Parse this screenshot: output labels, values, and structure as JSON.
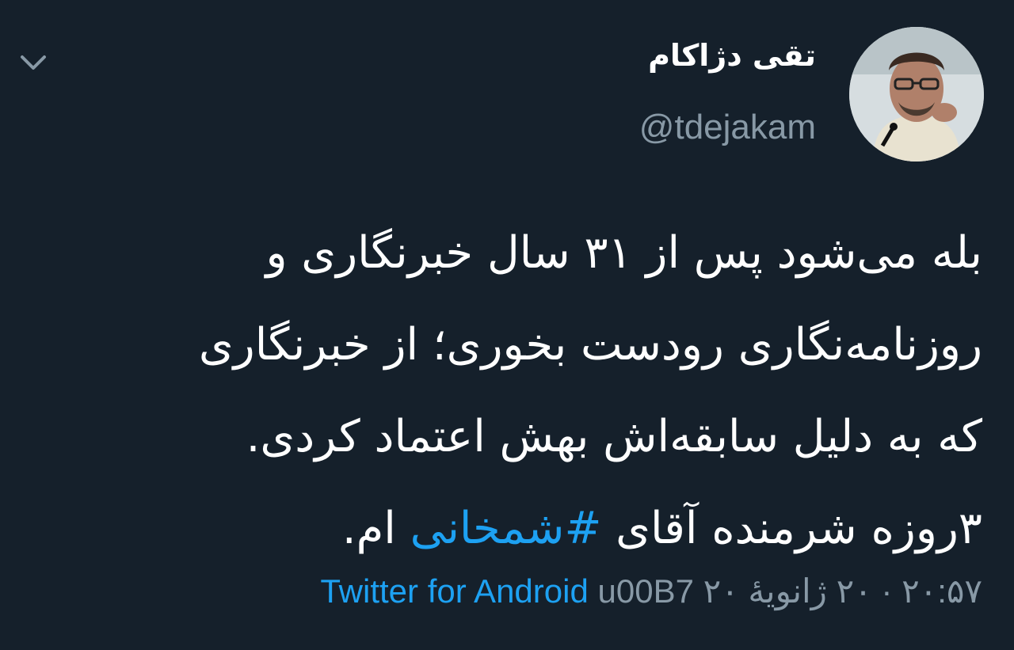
{
  "header": {
    "display_name": "تقی دژاکام",
    "handle": "@tdejakam"
  },
  "icons": {
    "menu": "chevron-down-icon",
    "avatar": "avatar"
  },
  "tweet": {
    "text_line_1": "بله می‌شود پس از ۳۱ سال خبرنگاری و",
    "text_line_2": "روزنامه‌نگاری رودست بخوری؛ از خبرنگاری",
    "text_line_3": "که به دلیل سابقه‌اش بهش اعتماد کردی.",
    "text_line_4_prefix": "۳روزه شرمنده آقای ",
    "hashtag": "#شمخانی",
    "text_line_4_suffix": " ام."
  },
  "meta": {
    "timestamp": "۲۰:۵۷ · ۲۰ ژانویهٔ ۲۰",
    "separator": "u00B7",
    "source": "Twitter for Android"
  },
  "colors": {
    "background": "#15202b",
    "text_primary": "#ffffff",
    "text_secondary": "#8899a6",
    "accent": "#1da1f2"
  }
}
